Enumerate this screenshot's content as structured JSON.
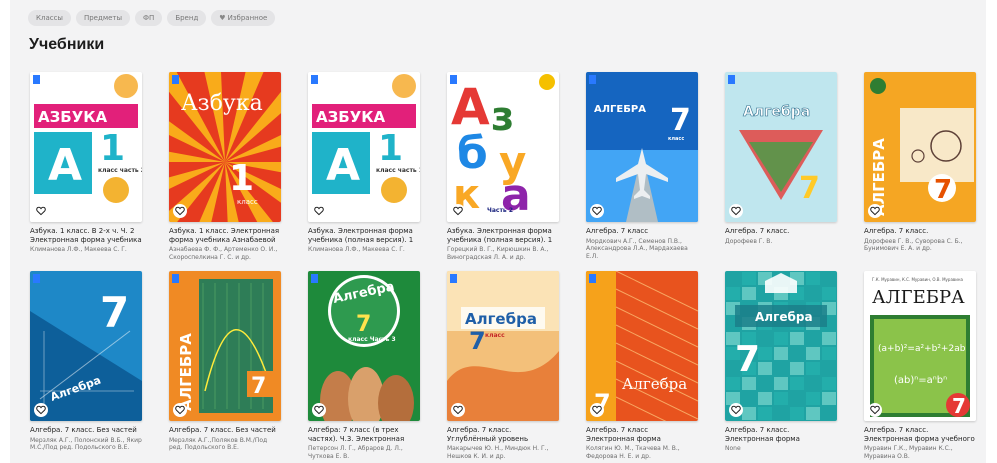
{
  "filters": [
    {
      "label": "Классы"
    },
    {
      "label": "Предметы"
    },
    {
      "label": "ФП"
    },
    {
      "label": "Бренд"
    },
    {
      "label": "Избранное",
      "icon": "heart-icon"
    }
  ],
  "page_title": "Учебники",
  "books": [
    {
      "title": "Азбука. 1 класс. В 2-х ч. Ч. 2 Электронная форма учебника",
      "authors": "Климанова Л.Ф., Макеева С. Г.",
      "cover": {
        "bg": "#ffffff",
        "accent": "#e2207a",
        "word": "АЗБУКА",
        "big": "1",
        "sub": "класс часть 2",
        "style": "azbuka"
      }
    },
    {
      "title": "Азбука. 1 класс. Электронная форма учебника Азнабаевой Ф.Ф...",
      "authors": "Азнабаева Ф. Ф., Артеменко О. И., Скороспелкина Г. С. и др.",
      "cover": {
        "bg": "#e63a1f",
        "accent": "#ffd21a",
        "word": "Азбука",
        "big": "1",
        "sub": "класс",
        "style": "rays"
      }
    },
    {
      "title": "Азбука. Электронная форма учебника (полная версия). 1 клас...",
      "authors": "Климанова Л.Ф., Макеева С. Г.",
      "cover": {
        "bg": "#ffffff",
        "accent": "#e2207a",
        "word": "АЗБУКА",
        "big": "1",
        "sub": "класс часть 1",
        "style": "azbuka"
      }
    },
    {
      "title": "Азбука. Электронная форма учебника (полная версия). 1 клас...",
      "authors": "Горецкий В. Г., Кирюшкин В. А., Виноградская Л. А. и др.",
      "cover": {
        "bg": "#ffffff",
        "accent": "#e53935",
        "word": "Азбука",
        "big": "",
        "sub": "Часть 2",
        "style": "letters"
      }
    },
    {
      "title": "Алгебра. 7 класс",
      "authors": "Мордкович А.Г., Семенов П.В., Александрова Л.А., Мардахаева Е.Л.",
      "cover": {
        "bg": "#1565c0",
        "accent": "#ffffff",
        "word": "АЛГЕБРА",
        "big": "7",
        "sub": "класс",
        "style": "plane"
      }
    },
    {
      "title": "Алгебра. 7 класс.",
      "authors": "Дорофеев Г. В.",
      "cover": {
        "bg": "#bfe6ee",
        "accent": "#e53935",
        "word": "Алгебра",
        "big": "7",
        "sub": "",
        "style": "shapes"
      }
    },
    {
      "title": "Алгебра. 7 класс.",
      "authors": "Дорофеев Г. В., Суворова С. Б., Бунимович Е. А. и др.",
      "cover": {
        "bg": "#f5a623",
        "accent": "#ffffff",
        "word": "АЛГЕБРА",
        "big": "7",
        "sub": "",
        "style": "bike"
      }
    },
    {
      "title": "Алгебра. 7 класс. Без частей",
      "authors": "Мерзляк А.Г., Полонский В.Б., Якир М.С./Под ред. Подольского В.Е.",
      "cover": {
        "bg": "#1e88c7",
        "accent": "#ffffff",
        "word": "Алгебра",
        "big": "7",
        "sub": "",
        "style": "blue7"
      }
    },
    {
      "title": "Алгебра. 7 класс. Без частей",
      "authors": "Мерзляк А.Г.,Поляков В.М./Под ред. Подольского В.Е.",
      "cover": {
        "bg": "#f08a24",
        "accent": "#ffffff",
        "word": "АЛГЕБРА",
        "big": "7",
        "sub": "",
        "style": "vertical"
      }
    },
    {
      "title": "Алгебра: 7 класс (в трех частях). Ч.3. Электронная форма учебника",
      "authors": "Петерсон Л. Г., Абраров Д. Л., Чуткова Е. В.",
      "cover": {
        "bg": "#1e8a3b",
        "accent": "#ffe34d",
        "word": "Алгебра",
        "big": "7",
        "sub": "класс Часть 3",
        "style": "students"
      }
    },
    {
      "title": "Алгебра. 7 класс. Углублённый уровень",
      "authors": "Макарычев Ю. Н., Миндюк Н. Г., Нешков К. И. и др.",
      "cover": {
        "bg": "#f3c07a",
        "accent": "#1f5fa8",
        "word": "Алгебра",
        "big": "7",
        "sub": "класс",
        "style": "deep"
      }
    },
    {
      "title": "Алгебра. 7 класс Электронная форма учебника.",
      "authors": "Колягин Ю. М., Ткачева М. В., Федорова Н. Е. и др.",
      "cover": {
        "bg": "#e8531e",
        "accent": "#ffffff",
        "word": "Алгебра",
        "big": "7",
        "sub": "",
        "style": "orange"
      }
    },
    {
      "title": "Алгебра. 7 класс. Электронная форма учебника. Полная версия....",
      "authors": "None",
      "cover": {
        "bg": "#1fa3a3",
        "accent": "#ffffff",
        "word": "Алгебра",
        "big": "7",
        "sub": "",
        "style": "teal"
      }
    },
    {
      "title": "Алгебра. 7 класс. Электронная форма учебного пособия. Без...",
      "authors": "Муравин Г.К., Муравин К.С., Муравина О.В.",
      "cover": {
        "bg": "#ffffff",
        "accent": "#1a7a3a",
        "word": "АЛГЕБРА",
        "big": "7",
        "sub": "",
        "style": "formula"
      }
    }
  ]
}
